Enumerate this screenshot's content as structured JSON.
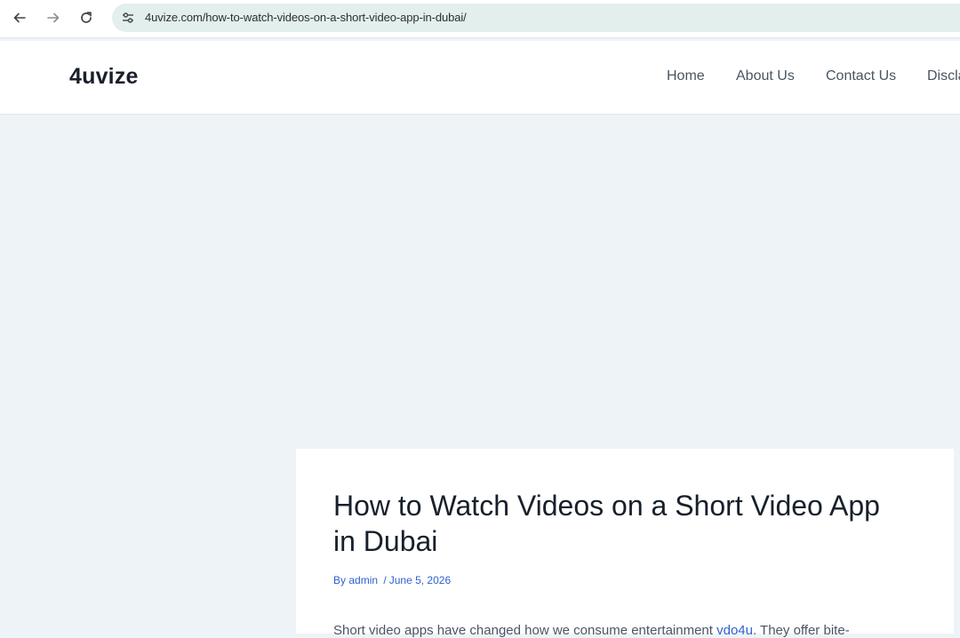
{
  "browser": {
    "url": "4uvize.com/how-to-watch-videos-on-a-short-video-app-in-dubai/",
    "icons": {
      "back": "arrow-left-icon",
      "forward": "arrow-right-icon",
      "reload": "reload-icon",
      "site_info": "tune-icon"
    }
  },
  "site": {
    "logo": "4uvize",
    "nav": {
      "home": "Home",
      "about": "About Us",
      "contact": "Contact Us",
      "disclaimer": "Discla"
    }
  },
  "article": {
    "title": "How to Watch Videos on a Short Video App in Dubai",
    "meta": {
      "author_prefix": "By",
      "author": "admin",
      "separator": "/",
      "date": "June 5, 2026"
    },
    "body_start": "Short video apps have changed how we consume entertainment",
    "body_link": "vdo4u",
    "body_end": ". They offer bite-"
  },
  "colors": {
    "page_bg": "#eef3f7",
    "address_bar_bg": "#e2efec",
    "link": "#2f5fd0"
  }
}
